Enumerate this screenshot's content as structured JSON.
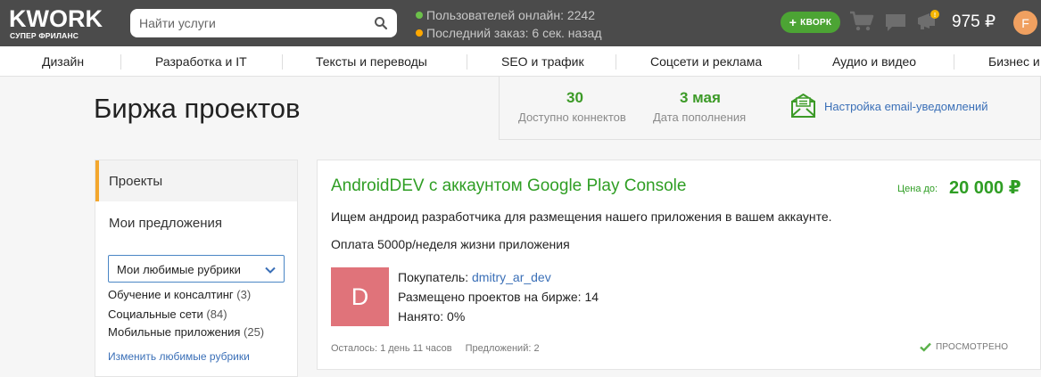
{
  "header": {
    "logo_text": "KWORK",
    "logo_tagline": "СУПЕР ФРИЛАНС",
    "search_placeholder": "Найти услуги",
    "online_text": "Пользователей онлайн: 2242",
    "last_order_text": "Последний заказ: 6 сек. назад",
    "kwork_button": "КВОРК",
    "balance": "975 ₽",
    "avatar_letter": "F",
    "colors": {
      "bar": "#4b4b4b",
      "online_dot": "#6cc04a",
      "order_dot": "#ffa800",
      "kwork_button": "#4ca434"
    }
  },
  "categories": [
    "Дизайн",
    "Разработка и IT",
    "Тексты и переводы",
    "SEO и трафик",
    "Соцсети и реклама",
    "Аудио и видео",
    "Бизнес и"
  ],
  "page_title": "Биржа проектов",
  "info": {
    "connects_value": "30",
    "connects_label": "Доступно коннектов",
    "refill_value": "3 мая",
    "refill_label": "Дата пополнения",
    "email_link": "Настройка email-уведомлений"
  },
  "sidebar": {
    "active_item": "Проекты",
    "item_offers": "Мои предложения",
    "select_value": "Мои любимые рубрики",
    "rubrics": [
      {
        "name": "Обучение и консалтинг",
        "count": "(3)"
      },
      {
        "name": "Социальные сети",
        "count": "(84)"
      },
      {
        "name": "Мобильные приложения",
        "count": "(25)"
      }
    ],
    "edit_link": "Изменить любимые рубрики"
  },
  "project": {
    "title": "AndroidDEV с аккаунтом Google Play Console",
    "price_label": "Цена до:",
    "price_value": "20 000 ₽",
    "description_1": "Ищем андроид разработчика для размещения нашего приложения в вашем аккаунте.",
    "description_2": "Оплата 5000р/неделя жизни приложения",
    "buyer_avatar_letter": "D",
    "buyer_label": "Покупатель:",
    "buyer_name": "dmitry_ar_dev",
    "projects_posted": "Размещено проектов на бирже: 14",
    "hired": "Нанято: 0%",
    "time_left": "Осталось: 1 день 11 часов",
    "offers": "Предложений: 2",
    "viewed_badge": "ПРОСМОТРЕНО",
    "colors": {
      "accent_green": "#2f9e24",
      "avatar_bg": "#e0737a"
    }
  }
}
